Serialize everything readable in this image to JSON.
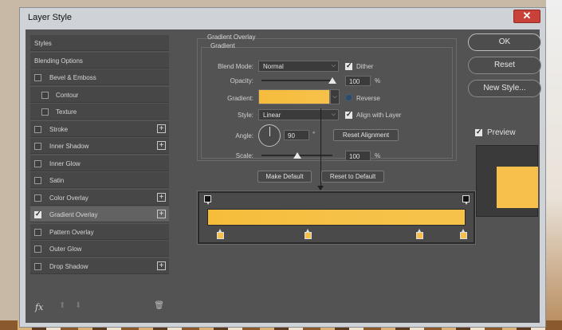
{
  "window": {
    "title": "Layer Style"
  },
  "styles_list": {
    "items": [
      {
        "label": "Styles",
        "checkbox": false,
        "checked": false,
        "plus": false,
        "indent": false
      },
      {
        "label": "Blending Options",
        "checkbox": false,
        "checked": false,
        "plus": false,
        "indent": false
      },
      {
        "label": "Bevel & Emboss",
        "checkbox": true,
        "checked": false,
        "plus": false,
        "indent": false
      },
      {
        "label": "Contour",
        "checkbox": true,
        "checked": false,
        "plus": false,
        "indent": true
      },
      {
        "label": "Texture",
        "checkbox": true,
        "checked": false,
        "plus": false,
        "indent": true
      },
      {
        "label": "Stroke",
        "checkbox": true,
        "checked": false,
        "plus": true,
        "indent": false
      },
      {
        "label": "Inner Shadow",
        "checkbox": true,
        "checked": false,
        "plus": true,
        "indent": false
      },
      {
        "label": "Inner Glow",
        "checkbox": true,
        "checked": false,
        "plus": false,
        "indent": false
      },
      {
        "label": "Satin",
        "checkbox": true,
        "checked": false,
        "plus": false,
        "indent": false
      },
      {
        "label": "Color Overlay",
        "checkbox": true,
        "checked": false,
        "plus": true,
        "indent": false
      },
      {
        "label": "Gradient Overlay",
        "checkbox": true,
        "checked": true,
        "plus": true,
        "indent": false,
        "active": true
      },
      {
        "label": "Pattern Overlay",
        "checkbox": true,
        "checked": false,
        "plus": false,
        "indent": false
      },
      {
        "label": "Outer Glow",
        "checkbox": true,
        "checked": false,
        "plus": false,
        "indent": false
      },
      {
        "label": "Drop Shadow",
        "checkbox": true,
        "checked": false,
        "plus": true,
        "indent": false
      }
    ],
    "footer": {
      "fx_label": "fx"
    }
  },
  "panel": {
    "group_title": "Gradient Overlay",
    "subgroup_title": "Gradient",
    "blend_mode": {
      "label": "Blend Mode:",
      "value": "Normal"
    },
    "dither": {
      "label": "Dither",
      "checked": true
    },
    "opacity": {
      "label": "Opacity:",
      "value": "100",
      "unit": "%",
      "level_percent": 100
    },
    "gradient": {
      "label": "Gradient:",
      "start_color": "#f6bd3c",
      "end_color": "#f7c24a"
    },
    "reverse": {
      "label": "Reverse",
      "checked": false
    },
    "style": {
      "label": "Style:",
      "value": "Linear"
    },
    "align_with_layer": {
      "label": "Align with Layer",
      "checked": true
    },
    "angle": {
      "label": "Angle:",
      "value": "90",
      "unit": "°"
    },
    "reset_alignment": "Reset Alignment",
    "scale": {
      "label": "Scale:",
      "value": "100",
      "unit": "%",
      "level_percent": 50
    },
    "make_default": "Make Default",
    "reset_to_default": "Reset to Default"
  },
  "gradient_editor": {
    "opacity_stops_percent": [
      0,
      100
    ],
    "color_stops_percent": [
      5,
      39,
      82,
      99
    ],
    "color": "#f6c04a"
  },
  "right": {
    "ok": "OK",
    "reset": "Reset",
    "new_style": "New Style...",
    "preview": {
      "label": "Preview",
      "checked": true
    },
    "preview_color": "#f6c04a"
  }
}
